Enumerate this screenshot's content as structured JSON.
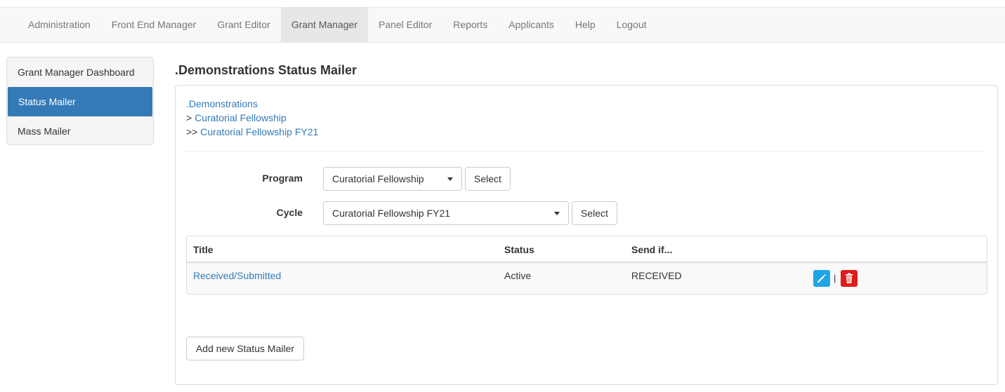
{
  "nav": {
    "items": [
      {
        "label": "Administration"
      },
      {
        "label": "Front End Manager"
      },
      {
        "label": "Grant Editor"
      },
      {
        "label": "Grant Manager",
        "active": true
      },
      {
        "label": "Panel Editor"
      },
      {
        "label": "Reports"
      },
      {
        "label": "Applicants"
      },
      {
        "label": "Help"
      },
      {
        "label": "Logout"
      }
    ]
  },
  "sidebar": {
    "items": [
      {
        "label": "Grant Manager Dashboard"
      },
      {
        "label": "Status Mailer",
        "active": true
      },
      {
        "label": "Mass Mailer"
      }
    ]
  },
  "page": {
    "title": ".Demonstrations Status Mailer"
  },
  "breadcrumb": {
    "level1": ".Demonstrations",
    "prefix2": "> ",
    "level2": "Curatorial Fellowship",
    "prefix3": ">> ",
    "level3": "Curatorial Fellowship FY21"
  },
  "form": {
    "program_label": "Program",
    "program_value": "Curatorial Fellowship",
    "cycle_label": "Cycle",
    "cycle_value": "Curatorial Fellowship FY21",
    "select_button": "Select"
  },
  "table": {
    "headers": {
      "title": "Title",
      "status": "Status",
      "send_if": "Send if..."
    },
    "rows": [
      {
        "title": "Received/Submitted",
        "status": "Active",
        "send_if": "RECEIVED"
      }
    ],
    "separator": "|"
  },
  "actions": {
    "add_button": "Add new Status Mailer"
  },
  "colors": {
    "primary": "#337ab7",
    "edit_icon": "#1fa5e6",
    "delete_icon": "#e01b1b"
  }
}
